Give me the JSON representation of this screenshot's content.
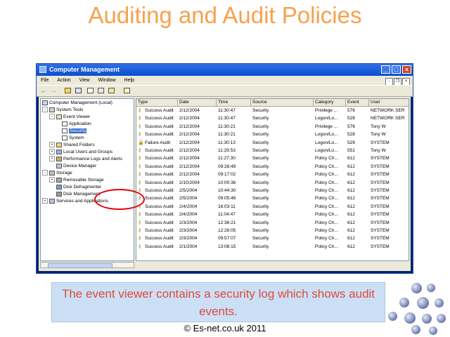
{
  "slide": {
    "title": "Auditing and Audit Policies",
    "caption": "The event viewer contains a security log which shows audit events.",
    "copyright": "© Es-net.co.uk 2011"
  },
  "window": {
    "title": "Computer Management",
    "menu": [
      "File",
      "Action",
      "View",
      "Window",
      "Help"
    ],
    "controls": {
      "minimize": "_",
      "maximize": "□",
      "close": "×"
    },
    "inner_controls": {
      "minimize": "-",
      "restore": "❐",
      "close": "×"
    }
  },
  "tree": {
    "root": "Computer Management (Local)",
    "system_tools": "System Tools",
    "event_viewer": "Event Viewer",
    "application": "Application",
    "security": "Security",
    "system": "System",
    "shared_folders": "Shared Folders",
    "local_users": "Local Users and Groups",
    "perf_logs": "Performance Logs and Alerts",
    "device_manager": "Device Manager",
    "storage": "Storage",
    "removable_storage": "Removable Storage",
    "disk_defrag": "Disk Defragmenter",
    "disk_management": "Disk Management",
    "services_apps": "Services and Applications"
  },
  "table": {
    "columns": [
      "Type",
      "Date",
      "Time",
      "Source",
      "Category",
      "Event",
      "User"
    ],
    "rows": [
      [
        "Success Audit",
        "2/12/2004",
        "11:30:47",
        "Security",
        "Privilege ...",
        "576",
        "NETWORK SER"
      ],
      [
        "Success Audit",
        "2/12/2004",
        "11:30:47",
        "Security",
        "Logon/Lo...",
        "528",
        "NETWORK SER"
      ],
      [
        "Success Audit",
        "2/12/2004",
        "11:30:21",
        "Security",
        "Privilege ...",
        "576",
        "Tony W"
      ],
      [
        "Success Audit",
        "2/12/2004",
        "11:30:21",
        "Security",
        "Logon/Lo...",
        "528",
        "Tony W"
      ],
      [
        "Failure Audit",
        "2/12/2004",
        "11:30:13",
        "Security",
        "Logon/Lo...",
        "529",
        "SYSTEM"
      ],
      [
        "Success Audit",
        "2/12/2004",
        "11:29:53",
        "Security",
        "Logon/Lo...",
        "551",
        "Tony W"
      ],
      [
        "Success Audit",
        "2/12/2004",
        "11:27:30",
        "Security",
        "Policy Ch...",
        "612",
        "SYSTEM"
      ],
      [
        "Success Audit",
        "2/12/2004",
        "09:28:49",
        "Security",
        "Policy Ch...",
        "612",
        "SYSTEM"
      ],
      [
        "Success Audit",
        "2/12/2004",
        "09:17:02",
        "Security",
        "Policy Ch...",
        "612",
        "SYSTEM"
      ],
      [
        "Success Audit",
        "2/10/2004",
        "10:00:36",
        "Security",
        "Policy Ch...",
        "612",
        "SYSTEM"
      ],
      [
        "Success Audit",
        "2/5/2004",
        "10:44:30",
        "Security",
        "Policy Ch...",
        "612",
        "SYSTEM"
      ],
      [
        "Success Audit",
        "2/5/2004",
        "09:05:46",
        "Security",
        "Policy Ch...",
        "612",
        "SYSTEM"
      ],
      [
        "Success Audit",
        "2/4/2004",
        "16:03:11",
        "Security",
        "Policy Ch...",
        "612",
        "SYSTEM"
      ],
      [
        "Success Audit",
        "2/4/2004",
        "11:04:47",
        "Security",
        "Policy Ch...",
        "612",
        "SYSTEM"
      ],
      [
        "Success Audit",
        "2/3/2004",
        "12:36:21",
        "Security",
        "Policy Ch...",
        "612",
        "SYSTEM"
      ],
      [
        "Success Audit",
        "2/3/2004",
        "12:26:05",
        "Security",
        "Policy Ch...",
        "612",
        "SYSTEM"
      ],
      [
        "Success Audit",
        "2/3/2004",
        "09:57:07",
        "Security",
        "Policy Ch...",
        "612",
        "SYSTEM"
      ],
      [
        "Success Audit",
        "2/1/2004",
        "13:08:15",
        "Security",
        "Policy Ch...",
        "612",
        "SYSTEM"
      ]
    ]
  },
  "colors": {
    "title": "#f7a14c",
    "caption_text": "#e04a3c",
    "caption_bg": "#cbe0f6",
    "highlight": "#e5000c",
    "titlebar": "#0a4fd0"
  }
}
